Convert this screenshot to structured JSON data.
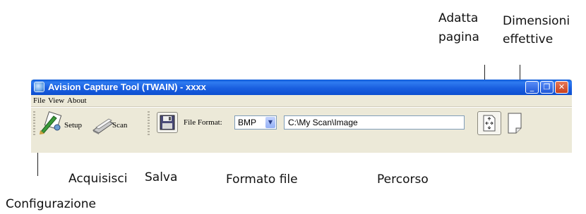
{
  "window": {
    "title": "Avision Capture Tool (TWAIN) - xxxx",
    "buttons": {
      "minimize": "_",
      "restore": "❐",
      "close": "✕"
    }
  },
  "menu": {
    "items": [
      "File",
      "View",
      "About"
    ]
  },
  "toolbar": {
    "setup_label": "Setup",
    "scan_label": "Scan",
    "file_format_label": "File Format:",
    "file_format_value": "BMP",
    "path_value": "C:\\My Scan\\Image"
  },
  "annotations": {
    "adatta_pagina_line1": "Adatta",
    "adatta_pagina_line2": "pagina",
    "dimensioni_line1": "Dimensioni",
    "dimensioni_line2": "effettive",
    "acquisisci": "Acquisisci",
    "salva": "Salva",
    "formato_file": "Formato file",
    "percorso": "Percorso",
    "configurazione": "Configurazione"
  },
  "icons": {
    "app": "app-icon",
    "setup": "setup-icon",
    "scan": "scanner-icon",
    "save": "floppy-disk-icon",
    "fit": "fit-page-icon",
    "actual": "actual-size-icon"
  },
  "colors": {
    "title_bar": "#0a58d8",
    "window_bg": "#ece9d8",
    "close_button": "#c8401c"
  }
}
